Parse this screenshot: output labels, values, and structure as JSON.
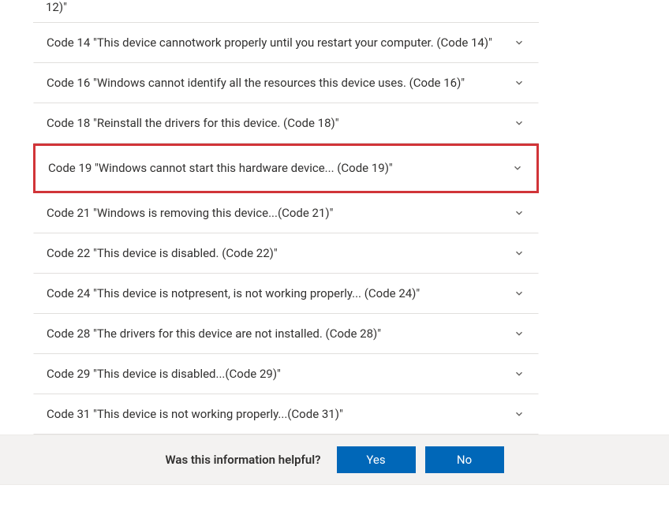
{
  "partial_top_line": "12)\"",
  "accordion": {
    "items": [
      {
        "label": "Code 14 \"This device cannotwork properly until you restart your computer. (Code 14)\"",
        "highlighted": false
      },
      {
        "label": "Code 16 \"Windows cannot identify all the resources this device uses. (Code 16)\"",
        "highlighted": false
      },
      {
        "label": "Code 18 \"Reinstall the drivers for this device. (Code 18)\"",
        "highlighted": false
      },
      {
        "label": "Code 19 \"Windows cannot start this hardware device... (Code 19)\"",
        "highlighted": true
      },
      {
        "label": "Code 21 \"Windows is removing this device...(Code 21)\"",
        "highlighted": false
      },
      {
        "label": "Code 22 \"This device is disabled. (Code 22)\"",
        "highlighted": false
      },
      {
        "label": "Code 24 \"This device is notpresent, is not working properly... (Code 24)\"",
        "highlighted": false
      },
      {
        "label": "Code 28 \"The drivers for this device are not installed. (Code 28)\"",
        "highlighted": false
      },
      {
        "label": "Code 29 \"This device is disabled...(Code 29)\"",
        "highlighted": false
      },
      {
        "label": "Code 31 \"This device is not working properly...(Code 31)\"",
        "highlighted": false
      }
    ]
  },
  "feedback": {
    "question": "Was this information helpful?",
    "yes_label": "Yes",
    "no_label": "No"
  }
}
